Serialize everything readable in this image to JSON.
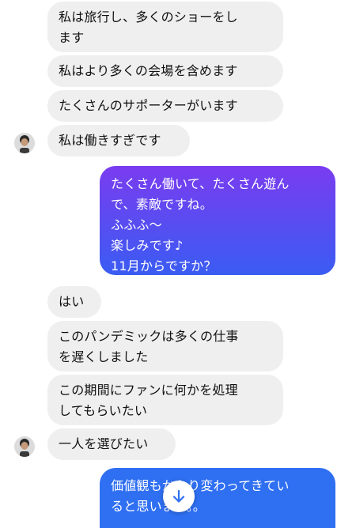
{
  "thread": {
    "incoming_group_1": [
      "私は旅行し、多くのショーをし\nます",
      "私はより多くの会場を含めます",
      "たくさんのサポーターがいます",
      "私は働きすぎです"
    ],
    "outgoing_1": "たくさん働いて、たくさん遊ん\nで、素敵ですね。\nふふふ〜\n楽しみです♪\n11月からですか？",
    "incoming_group_2": [
      "はい",
      "このパンデミックは多くの仕事\nを遅くしました",
      "この期間にファンに何かを処理\nしてもらいたい",
      "一人を選びたい"
    ],
    "outgoing_2": "価値観もかなり変わってきてい\nると思います。。"
  },
  "colors": {
    "incoming_bubble": "#efefef",
    "outgoing_gradient_top": "#7a3cf0",
    "outgoing_gradient_bottom": "#3a5cf2",
    "outgoing_blue": "#2f6ff2"
  },
  "icons": {
    "scroll_down": "arrow-down-icon",
    "avatar": "contact-avatar"
  }
}
